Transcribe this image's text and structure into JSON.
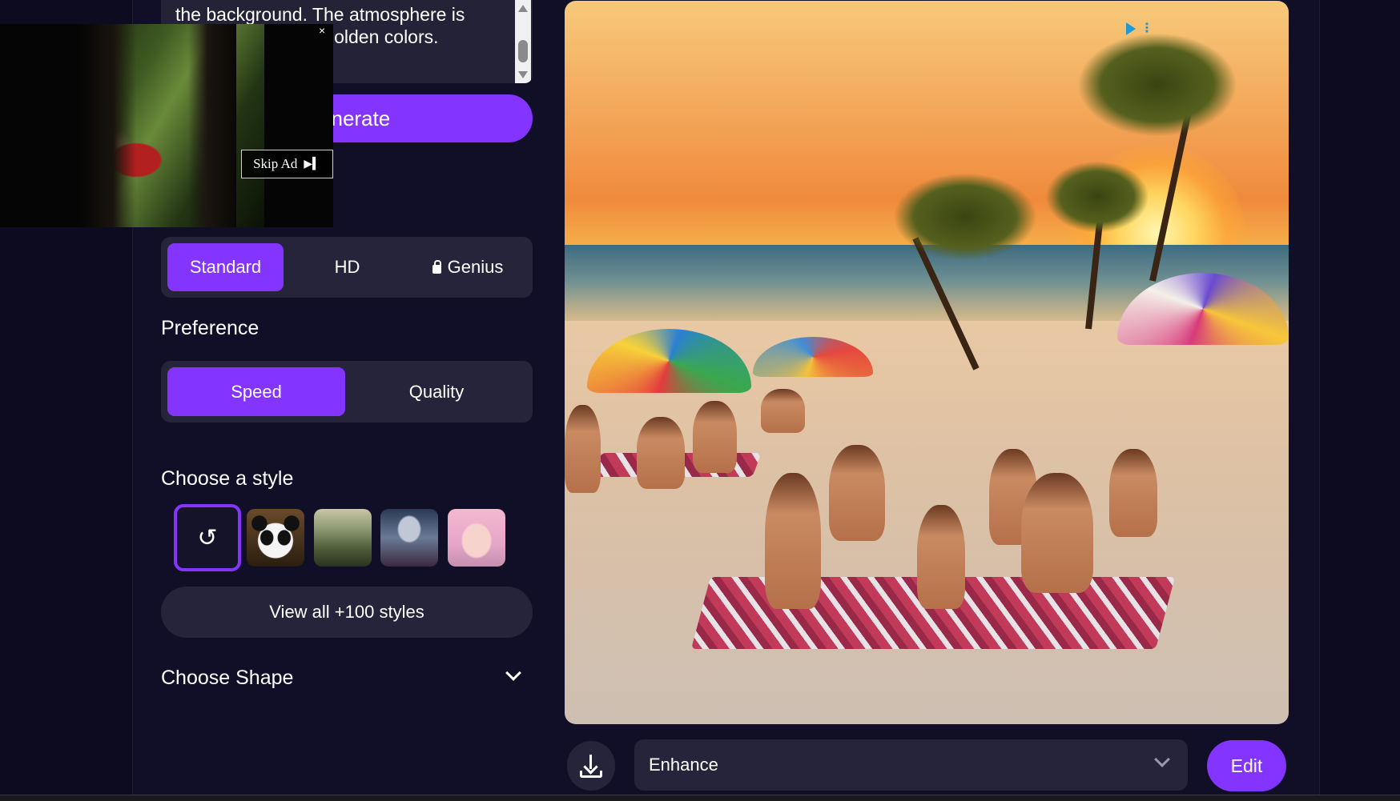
{
  "prompt": {
    "text": "the background. The atmosphere is vibrant with warm golden colors."
  },
  "generate_button": {
    "label": "Generate"
  },
  "ad": {
    "skip_label": "Skip Ad",
    "close_glyph": "×",
    "skip_glyph": "▶▍"
  },
  "quality_mode": {
    "options": [
      {
        "label": "Standard",
        "active": true
      },
      {
        "label": "HD",
        "active": false
      },
      {
        "label": "Genius",
        "active": false,
        "locked": true
      }
    ]
  },
  "preference": {
    "title": "Preference",
    "options": [
      {
        "label": "Speed",
        "active": true
      },
      {
        "label": "Quality",
        "active": false
      }
    ]
  },
  "style": {
    "title": "Choose a style",
    "selected_glyph": "↺",
    "thumbnails": [
      "none",
      "panda",
      "forest",
      "robot",
      "anime-girl"
    ],
    "view_all_label": "View all +100 styles"
  },
  "shape": {
    "title": "Choose Shape"
  },
  "actions": {
    "enhance_value": "Enhance",
    "edit_label": "Edit"
  },
  "colors": {
    "accent": "#8434ff",
    "background": "#110f27",
    "panel": "#26243a"
  }
}
